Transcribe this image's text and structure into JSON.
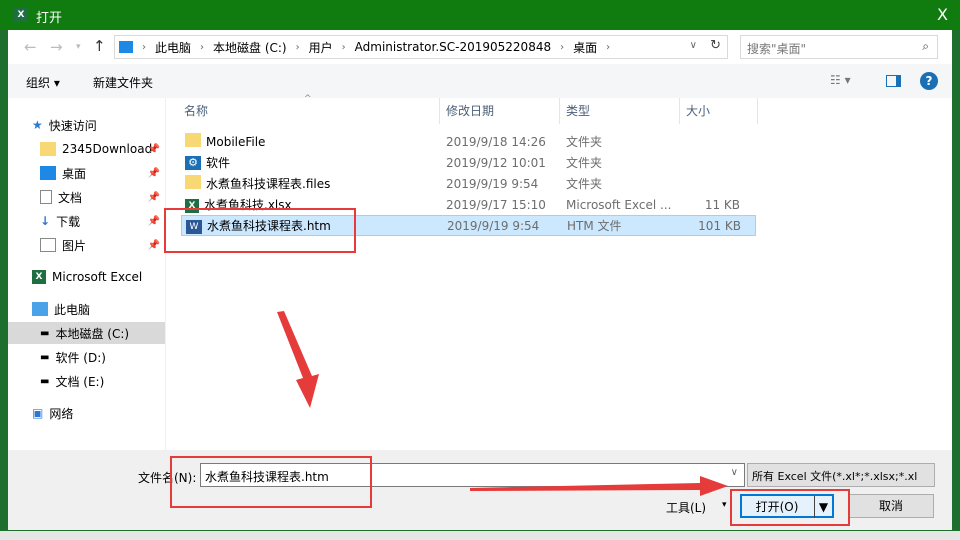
{
  "window": {
    "title": "打开",
    "close": "X"
  },
  "address": {
    "path": [
      "此电脑",
      "本地磁盘 (C:)",
      "用户",
      "Administrator.SC-201905220848",
      "桌面"
    ],
    "search_placeholder": "搜索\"桌面\""
  },
  "toolbar": {
    "organize": "组织 ▾",
    "new_folder": "新建文件夹",
    "help": "?"
  },
  "sidebar": {
    "quick_access": "快速访问",
    "items": [
      "2345Download",
      "桌面",
      "文档",
      "下载",
      "图片"
    ],
    "excel": "Microsoft Excel",
    "this_pc": "此电脑",
    "drives": [
      "本地磁盘 (C:)",
      "软件 (D:)",
      "文档 (E:)"
    ],
    "network": "网络"
  },
  "columns": {
    "name": "名称",
    "date": "修改日期",
    "type": "类型",
    "size": "大小"
  },
  "files": [
    {
      "name": "MobileFile",
      "date": "2019/9/18 14:26",
      "type": "文件夹",
      "size": ""
    },
    {
      "name": "软件",
      "date": "2019/9/12 10:01",
      "type": "文件夹",
      "size": ""
    },
    {
      "name": "水煮鱼科技课程表.files",
      "date": "2019/9/19 9:54",
      "type": "文件夹",
      "size": ""
    },
    {
      "name": "水煮鱼科技.xlsx",
      "date": "2019/9/17 15:10",
      "type": "Microsoft Excel ...",
      "size": "11 KB"
    },
    {
      "name": "水煮鱼科技课程表.htm",
      "date": "2019/9/19 9:54",
      "type": "HTM 文件",
      "size": "101 KB"
    }
  ],
  "footer": {
    "filename_label": "文件名(N):",
    "filename_value": "水煮鱼科技课程表.htm",
    "filter": "所有 Excel 文件(*.xl*;*.xlsx;*.xl",
    "tools": "工具(L)",
    "open": "打开(O)",
    "cancel": "取消"
  },
  "colors": {
    "title": "#107c10",
    "annotation": "#e63b3b"
  }
}
